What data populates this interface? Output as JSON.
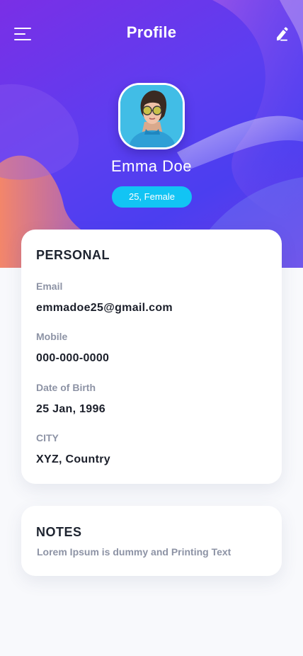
{
  "header": {
    "title": "Profile",
    "menu_icon": "hamburger-menu-icon",
    "edit_icon": "pencil-edit-icon"
  },
  "profile": {
    "name": "Emma Doe",
    "badge": "25, Female",
    "avatar_alt": "avatar-photo"
  },
  "personal": {
    "title": "PERSONAL",
    "fields": [
      {
        "label": "Email",
        "value": "emmadoe25@gmail.com"
      },
      {
        "label": "Mobile",
        "value": "000-000-0000"
      },
      {
        "label": "Date of Birth",
        "value": "25 Jan, 1996"
      },
      {
        "label": "CITY",
        "value": "XYZ, Country"
      }
    ]
  },
  "notes": {
    "title": "NOTES",
    "text": "Lorem Ipsum is dummy and Printing Text"
  },
  "colors": {
    "hero_primary": "#5c3ef0",
    "badge": "#12c4f4",
    "accent_orange": "#f07a5a"
  }
}
